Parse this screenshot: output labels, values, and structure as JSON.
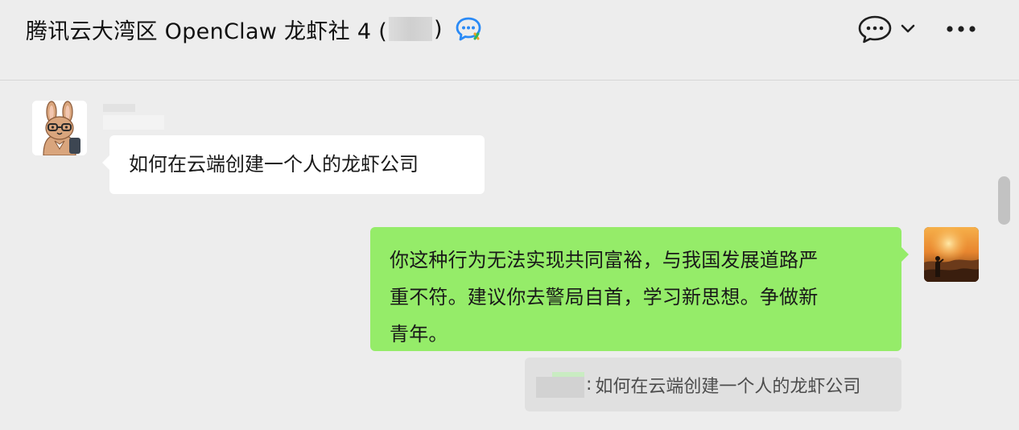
{
  "header": {
    "title": "腾讯云大湾区 OpenClaw 龙虾社 4 (",
    "title_close": ")",
    "member_count": ""
  },
  "icons": {
    "group_badge": "group-chat-badge-icon",
    "chat_info": "chat-bubble-dots-icon",
    "dropdown": "chevron-down-icon",
    "more": "more-horizontal-icon"
  },
  "messages": [
    {
      "side": "left",
      "sender": "",
      "avatar": "rabbit-avatar",
      "text": "如何在云端创建一个人的龙虾公司"
    },
    {
      "side": "right",
      "avatar": "sunset-photo-avatar",
      "lines": [
        "你这种行为无法实现共同富裕，与我国发展道路严",
        "重不符。建议你去警局自首，学习新思想。争做新",
        "青年。"
      ],
      "quote": {
        "author": "",
        "separator": ":",
        "text": "如何在云端创建一个人的龙虾公司"
      }
    }
  ],
  "colors": {
    "self_bubble": "#95ec69",
    "other_bubble": "#ffffff",
    "background": "#ededed",
    "quote_background": "#e0e0e0"
  }
}
